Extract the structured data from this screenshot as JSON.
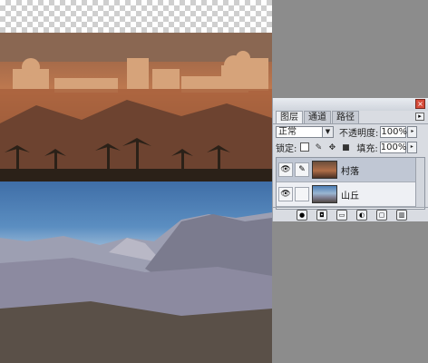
{
  "layers_panel": {
    "tabs": [
      {
        "label": "图层",
        "active": true
      },
      {
        "label": "通道",
        "active": false
      },
      {
        "label": "路径",
        "active": false
      }
    ],
    "blend_mode": "正常",
    "opacity_label": "不透明度:",
    "opacity_value": "100%",
    "lock_label": "锁定:",
    "fill_label": "填充:",
    "fill_value": "100%",
    "layers": [
      {
        "name": "村落",
        "selected": true
      },
      {
        "name": "山丘",
        "selected": false
      }
    ]
  }
}
